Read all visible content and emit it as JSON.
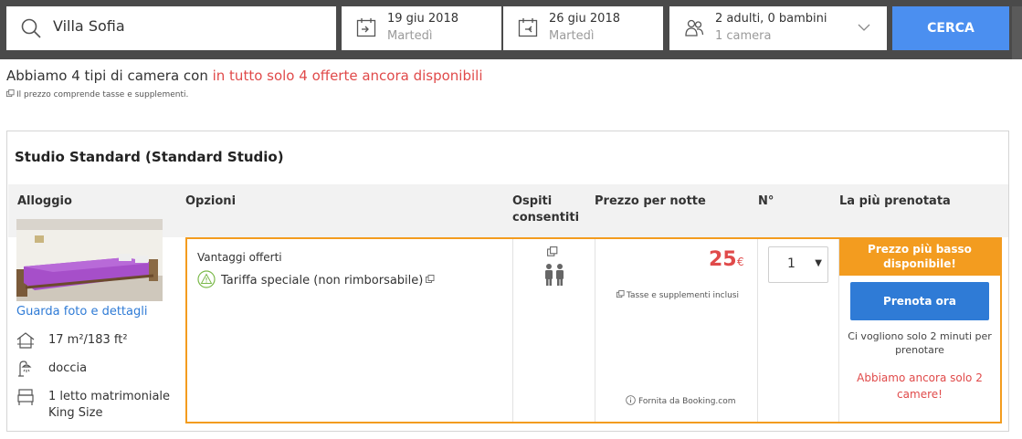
{
  "search": {
    "destination": "Villa Sofia",
    "checkin": {
      "date": "19 giu 2018",
      "day": "Martedì"
    },
    "checkout": {
      "date": "26 giu 2018",
      "day": "Martedì"
    },
    "guests": {
      "line1": "2 adulti, 0 bambini",
      "line2": "1 camera"
    },
    "button_label": "CERCA",
    "colors": {
      "bar_bg": "#4a4a4a",
      "button": "#4b8ff0"
    }
  },
  "summary": {
    "prefix": "Abbiamo 4 tipi di camera con ",
    "highlight": "in tutto solo 4 offerte ancora disponibili",
    "note": "Il prezzo comprende tasse e supplementi."
  },
  "room": {
    "title": "Studio Standard (Standard Studio)",
    "columns": {
      "accommodation": "Alloggio",
      "options": "Opzioni",
      "guests_line1": "Ospiti",
      "guests_line2": "consentiti",
      "price": "Prezzo per notte",
      "number": "N°",
      "most_booked": "La più prenotata"
    },
    "photo_link": "Guarda foto e dettagli",
    "features": [
      {
        "icon": "house-icon",
        "text": "17 m²/183 ft²"
      },
      {
        "icon": "shower-icon",
        "text": "doccia"
      },
      {
        "icon": "bed-icon",
        "text": "1 letto matrimoniale King Size"
      }
    ],
    "offer": {
      "benefits_title": "Vantaggi offerti",
      "rate": "Tariffa speciale (non rimborsabile)",
      "price_value": "25",
      "currency": "€",
      "tax_note": "Tasse e supplementi inclusi",
      "provider": "Fornita da Booking.com",
      "quantity": "1",
      "best_price": "Prezzo più basso disponibile!",
      "book_button": "Prenota ora",
      "minutes_note": "Ci vogliono solo 2 minuti per prenotare",
      "rooms_left": "Abbiamo ancora solo 2 camere!",
      "colors": {
        "border": "#f39c1f",
        "price": "#e04a4a",
        "book": "#2f7bd6"
      }
    }
  }
}
